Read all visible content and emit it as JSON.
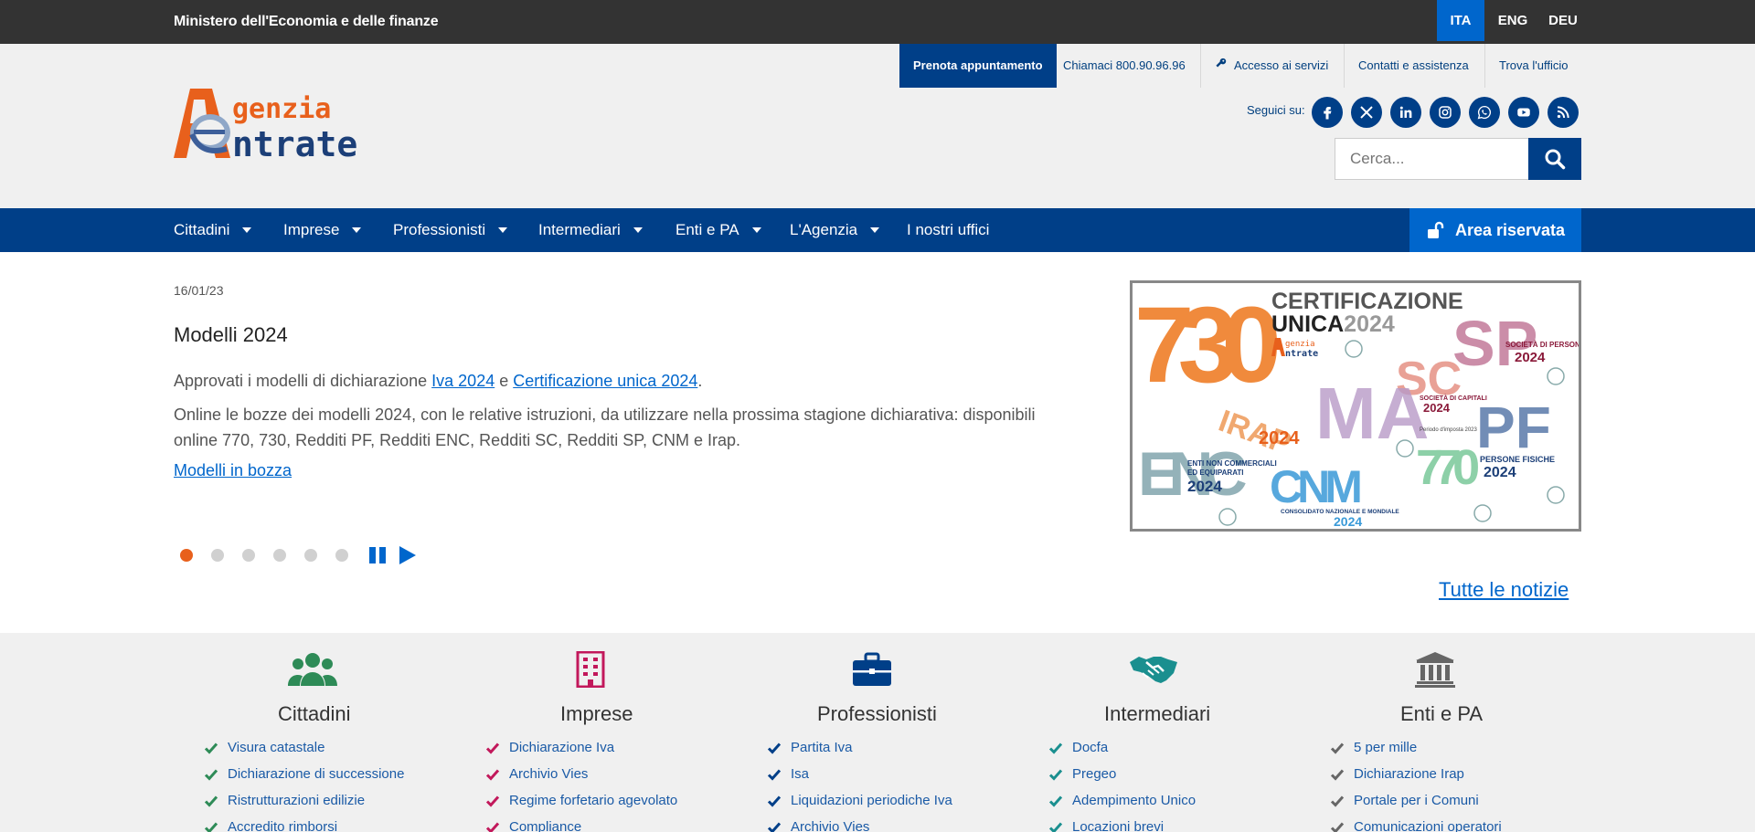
{
  "topbar": {
    "ministry": "Ministero dell'Economia e delle finanze",
    "languages": [
      "ITA",
      "ENG",
      "DEU"
    ],
    "active_language": "ITA"
  },
  "utility_links": {
    "prenota": "Prenota appuntamento",
    "chiamaci": "Chiamaci 800.90.96.96",
    "accesso": "Accesso ai servizi",
    "contatti": "Contatti e assistenza",
    "trova": "Trova l'ufficio"
  },
  "logo": {
    "line1": "genzia",
    "line2": "ntrate"
  },
  "social": {
    "label": "Seguici su:",
    "icons": [
      "facebook-icon",
      "x-icon",
      "linkedin-icon",
      "instagram-icon",
      "whatsapp-icon",
      "youtube-icon",
      "rss-icon"
    ]
  },
  "search": {
    "placeholder": "Cerca..."
  },
  "nav": {
    "items": [
      {
        "label": "Cittadini"
      },
      {
        "label": "Imprese"
      },
      {
        "label": "Professionisti"
      },
      {
        "label": "Intermediari"
      },
      {
        "label": "Enti e PA"
      },
      {
        "label": "L'Agenzia"
      },
      {
        "label": "I nostri uffici"
      }
    ],
    "area_riservata": "Area riservata"
  },
  "news": {
    "date": "16/01/23",
    "title": "Modelli 2024",
    "p1_prefix": "Approvati i modelli di dichiarazione ",
    "p1_link1": "Iva 2024",
    "p1_mid": " e ",
    "p1_link2": "Certificazione unica 2024",
    "p1_suffix": ".",
    "p2": "Online le bozze dei modelli 2024, con le relative istruzioni, da utilizzare nella prossima stagione dichiarativa: disponibili online 770, 730, Redditi PF, Redditi ENC, Redditi SC, Redditi SP, CNM e Irap.",
    "link": "Modelli in bozza",
    "slides": 6,
    "active_slide": 1,
    "all_news": "Tutte le notizie"
  },
  "promo": {
    "cu_title_1": "CERTIFICAZIONE",
    "cu_title_2": "UNICA",
    "cu_year": "2024",
    "n730": "730",
    "n770": "770",
    "irap": "IRAP",
    "irap_year": "2024",
    "ma": "MA",
    "sc": "SC",
    "sp": "SP",
    "sp_label": "SOCIETÀ DI PERSONE",
    "sp_year": "2024",
    "sc_label": "SOCIETÀ DI CAPITALI",
    "sc_year": "2024",
    "sc_period": "Periodo d'imposta 2023",
    "pf": "PF",
    "pf_label": "PERSONE FISICHE",
    "pf_year": "2024",
    "enc": "ENC",
    "enc_label_1": "ENTI NON COMMERCIALI",
    "enc_label_2": "ED EQUIPARATI",
    "enc_year": "2024",
    "cnm": "CNM",
    "cnm_label": "CONSOLIDATO NAZIONALE E MONDIALE",
    "cnm_year": "2024",
    "mini_logo_1": "genzia",
    "mini_logo_2": "ntrate"
  },
  "categories": [
    {
      "title": "Cittadini",
      "color": "#2e8b57",
      "items": [
        "Visura catastale",
        "Dichiarazione di successione",
        "Ristrutturazioni edilizie",
        "Accredito rimborsi"
      ]
    },
    {
      "title": "Imprese",
      "color": "#c2185b",
      "items": [
        "Dichiarazione Iva",
        "Archivio Vies",
        "Regime forfetario agevolato",
        "Compliance"
      ]
    },
    {
      "title": "Professionisti",
      "color": "#003f88",
      "items": [
        "Partita Iva",
        "Isa",
        "Liquidazioni periodiche Iva",
        "Archivio Vies"
      ]
    },
    {
      "title": "Intermediari",
      "color": "#1a8f8f",
      "items": [
        "Docfa",
        "Pregeo",
        "Adempimento Unico",
        "Locazioni brevi"
      ]
    },
    {
      "title": "Enti e PA",
      "color": "#666666",
      "items": [
        "5 per mille",
        "Dichiarazione Irap",
        "Portale per i Comuni",
        "Comunicazioni operatori"
      ]
    }
  ]
}
